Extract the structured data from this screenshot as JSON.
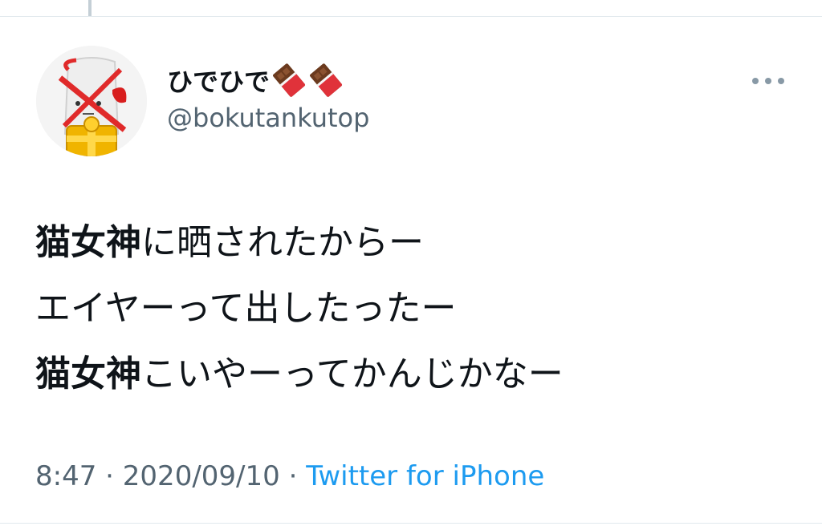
{
  "tweet": {
    "display_name": "ひでひで",
    "name_emoji": [
      "chocolate-bar-icon",
      "chocolate-bar-icon"
    ],
    "handle": "@bokutankutop",
    "lines": [
      {
        "bold": "猫女神",
        "rest": "に晒されたからー"
      },
      {
        "bold": "",
        "rest": "エイヤーって出したったー"
      },
      {
        "bold": "猫女神",
        "rest": "こいやーってかんじかなー"
      }
    ],
    "time": "8:47",
    "separator": "·",
    "date": "2020/09/10",
    "source": "Twitter for iPhone"
  },
  "colors": {
    "text_primary": "#0f1419",
    "text_secondary": "#536471",
    "link": "#1d9bf0",
    "divider": "#e1e8ed"
  }
}
